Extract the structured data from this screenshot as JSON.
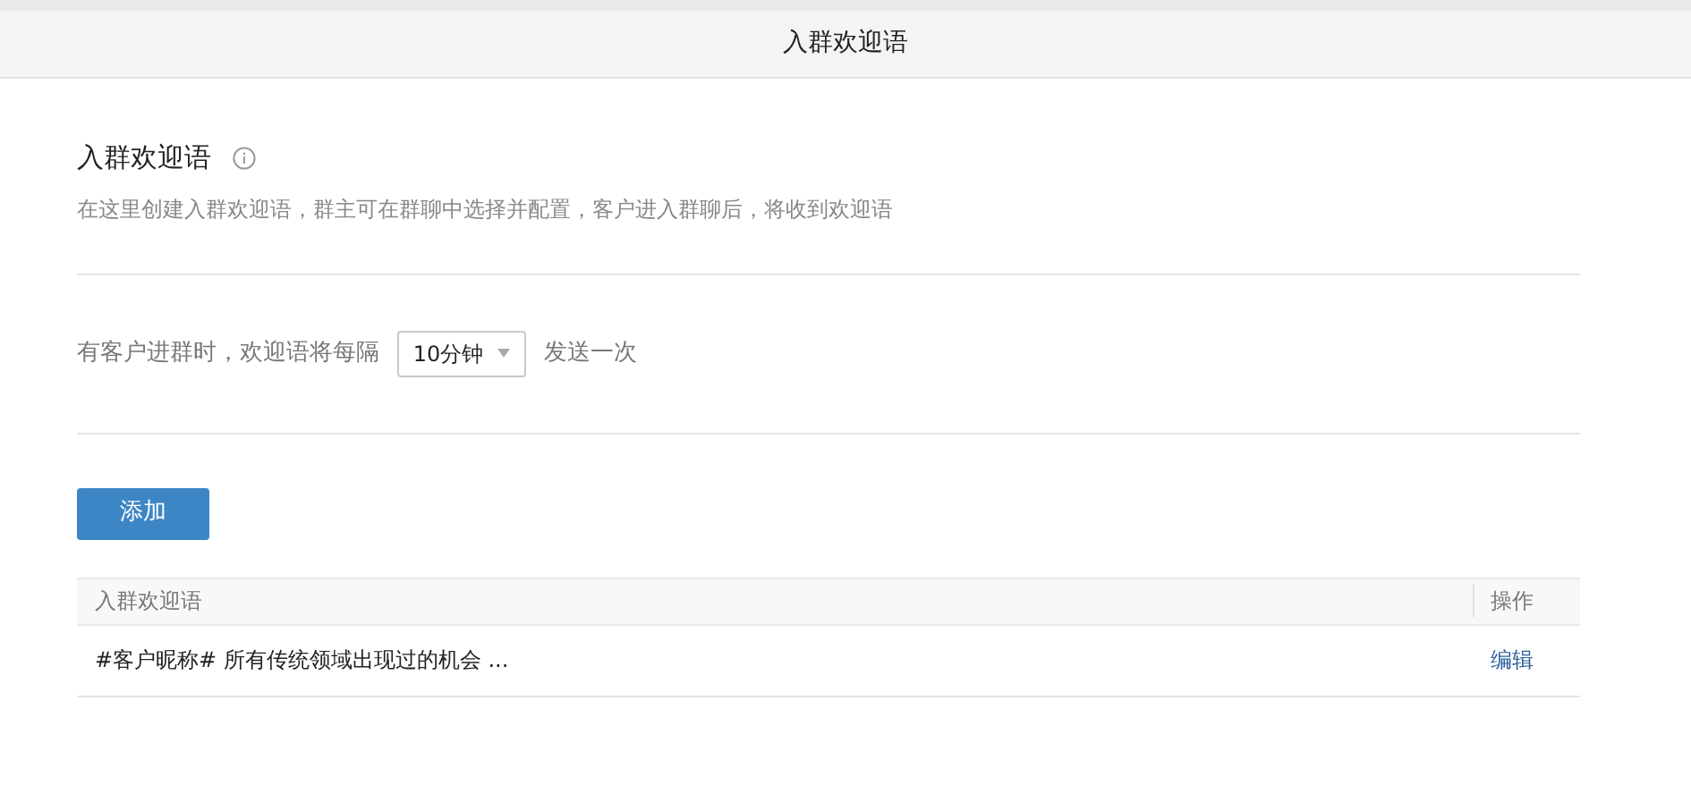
{
  "header": {
    "title": "入群欢迎语"
  },
  "section": {
    "title": "入群欢迎语",
    "description": "在这里创建入群欢迎语，群主可在群聊中选择并配置，客户进入群聊后，将收到欢迎语"
  },
  "interval": {
    "prefix": "有客户进群时，欢迎语将每隔",
    "value": "10分钟",
    "suffix": "发送一次"
  },
  "add_button": "添加",
  "table": {
    "columns": [
      "入群欢迎语",
      "操作"
    ],
    "rows": [
      {
        "message": "#客户昵称# 所有传统领域出现过的机会 ...",
        "action": "编辑"
      }
    ]
  }
}
